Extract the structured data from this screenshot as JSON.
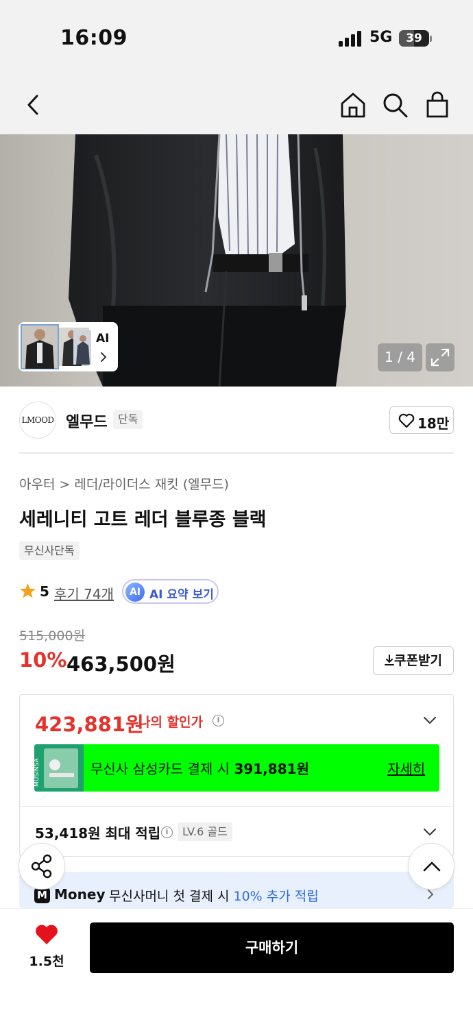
{
  "status_bar": {
    "time": "16:09",
    "network": "5G",
    "battery": "39"
  },
  "nav": {
    "back_icon": "chevron-left-icon",
    "home_icon": "home-icon",
    "search_icon": "search-icon",
    "cart_icon": "shopping-bag-icon"
  },
  "gallery": {
    "thumb_label": "AI",
    "counter": "1 / 4"
  },
  "brand": {
    "logo_text": "LMOOD",
    "name": "엘무드",
    "tag": "단독",
    "likes": "18만"
  },
  "product": {
    "breadcrumb": [
      "아우터",
      "레더/라이더스 재킷 (엘무드)"
    ],
    "title": "세레니티 고트 레더 블루종 블랙",
    "exclusive_tag": "무신사단독",
    "rating": "5",
    "review_link": "후기 74개",
    "ai_badge": "AI",
    "ai_summary": "AI 요약 보기"
  },
  "price": {
    "original": "515,000원",
    "discount": "10%",
    "sale": "463,500원",
    "coupon_button": "쿠폰받기"
  },
  "benefits": {
    "my_price": "423,881원",
    "my_price_label": "나의 할인가",
    "card_banner_prefix": "무신사 삼성카드 결제 시 ",
    "card_banner_price": "391,881원",
    "card_banner_more": "자세히",
    "points": "53,418원 최대 적립",
    "level": "LV.6 골드"
  },
  "money_banner": {
    "logo": "M",
    "brand": "Money",
    "text_prefix": "무신사머니 첫 결제 시 ",
    "text_highlight": "10% 추가 적립"
  },
  "bottom": {
    "wish_count": "1.5천",
    "buy_button": "구매하기"
  },
  "colors": {
    "accent_red": "#e5322b",
    "banner_green": "#00ff00",
    "link_blue": "#2f6ce0"
  }
}
